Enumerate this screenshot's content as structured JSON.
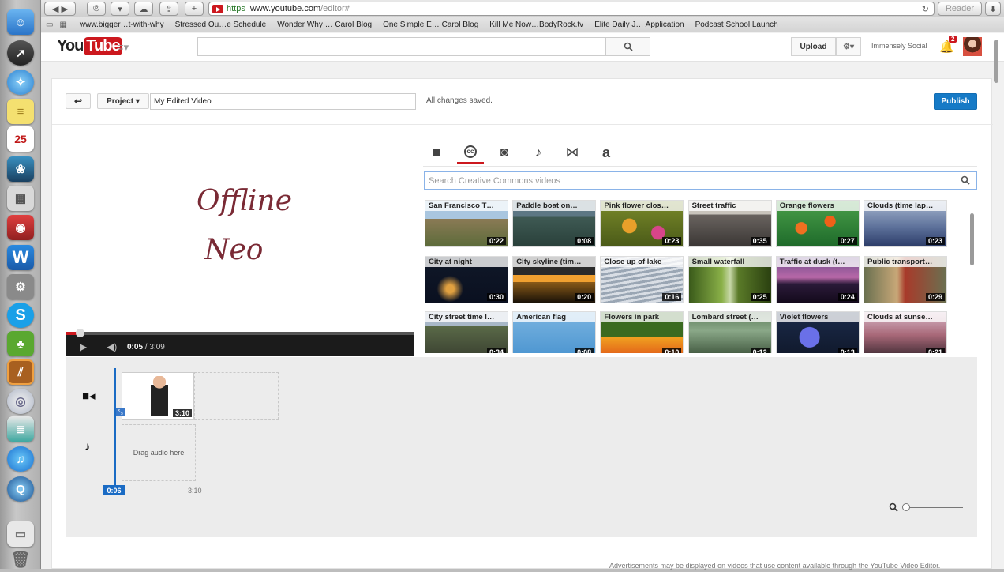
{
  "browser": {
    "url_scheme": "https",
    "url_host": "www.youtube.com",
    "url_path": "/editor#",
    "reader_label": "Reader"
  },
  "bookmarks": [
    "www.bigger…t-with-why",
    "Stressed Ou…e Schedule",
    "Wonder Why … Carol Blog",
    "One Simple E… Carol Blog",
    "Kill Me Now…BodyRock.tv",
    "Elite Daily J… Application",
    "Podcast School Launch"
  ],
  "dock": {
    "calendar_day": "25"
  },
  "header": {
    "logo_you": "You",
    "logo_tube": "Tube",
    "upload_label": "Upload",
    "account_name": "Immensely Social",
    "notification_count": "2"
  },
  "project": {
    "project_menu_label": "Project",
    "title_value": "My Edited Video",
    "status_text": "All changes saved.",
    "publish_label": "Publish"
  },
  "preview": {
    "title_line1": "Offline",
    "title_line2": "Neo",
    "current_time": "0:05",
    "duration": "3:09"
  },
  "library": {
    "tabs": [
      {
        "name": "tab-my-videos",
        "icon": "video-camera-icon",
        "glyph": "■"
      },
      {
        "name": "tab-creative-commons",
        "icon": "creative-commons-icon",
        "glyph": "cc"
      },
      {
        "name": "tab-photos",
        "icon": "camera-icon",
        "glyph": "◙"
      },
      {
        "name": "tab-audio",
        "icon": "music-note-icon",
        "glyph": "♪"
      },
      {
        "name": "tab-transitions",
        "icon": "transitions-icon",
        "glyph": "⋈"
      },
      {
        "name": "tab-text",
        "icon": "text-icon",
        "glyph": "a"
      }
    ],
    "active_tab": 1,
    "search_placeholder": "Search Creative Commons videos",
    "videos": [
      {
        "title": "San Francisco T…",
        "duration": "0:22",
        "bg": "linear-gradient(#a9c6df 0 40%,#8a7a55 40%,#5c6b3a)"
      },
      {
        "title": "Paddle boat on…",
        "duration": "0:08",
        "bg": "linear-gradient(#5d7784 0 35%,#3f5a54 35%,#29403a)"
      },
      {
        "title": "Pink flower clos…",
        "duration": "0:23",
        "bg": "radial-gradient(circle at 35% 55%,#e8a02a 0 12%,transparent 13%),radial-gradient(circle at 70% 70%,#d8458a 0 10%,transparent 11%),linear-gradient(#7a8a2a,#4a5a18)"
      },
      {
        "title": "Street traffic",
        "duration": "0:35",
        "bg": "linear-gradient(#c9c4bc 0 30%,#6a6460 30%,#3a3634)"
      },
      {
        "title": "Orange flowers",
        "duration": "0:27",
        "bg": "radial-gradient(circle at 30% 60%,#f07020 0 9%,transparent 10%),radial-gradient(circle at 65% 45%,#f06018 0 9%,transparent 10%),linear-gradient(#4aa04a,#1e6a2a)"
      },
      {
        "title": "Clouds (time lap…",
        "duration": "0:23",
        "bg": "linear-gradient(#a8b8d0,#5a6e98 60%,#2c3c68)"
      },
      {
        "title": "City at night",
        "duration": "0:30",
        "bg": "radial-gradient(circle at 30% 70%,#e0a040 0 6%,transparent 20%),linear-gradient(#101828,#0a1020)"
      },
      {
        "title": "City skyline (tim…",
        "duration": "0:20",
        "bg": "linear-gradient(#2a2a2a 0 40%,#f0a030 40% 55%,#8a5a18 55%,#1a1208)"
      },
      {
        "title": "Close up of lake",
        "duration": "0:16",
        "bg": "repeating-linear-gradient(170deg,#d8dde4 0 3px,#9aa6b4 3px 6px)"
      },
      {
        "title": "Small waterfall",
        "duration": "0:25",
        "bg": "linear-gradient(90deg,#3a5a1a,#8ab048 40%,#c8d8a8 50%,#5a7a28 60%,#2a4010)"
      },
      {
        "title": "Traffic at dusk (t…",
        "duration": "0:24",
        "bg": "linear-gradient(#6a4a8a,#b868a8 45%,#2a1a38 60%,#140a1c)"
      },
      {
        "title": "Public transport…",
        "duration": "0:29",
        "bg": "linear-gradient(90deg,#6a7050,#c8a878 40%,#a83a2a 50%,#6a7050)"
      },
      {
        "title": "City street time l…",
        "duration": "0:34",
        "bg": "linear-gradient(#a8b8c8 0 30%,#5a6a48 30%,#3a4030)"
      },
      {
        "title": "American flag",
        "duration": "0:08",
        "bg": "linear-gradient(#7ab4e0,#4a94d0)"
      },
      {
        "title": "Flowers in park",
        "duration": "0:10",
        "bg": "linear-gradient(#3a6a20 0 55%,#f0a020 55%,#e05818)"
      },
      {
        "title": "Lombard street (…",
        "duration": "0:12",
        "bg": "linear-gradient(#5a7a58,#8aa888 40%,#3a5038)"
      },
      {
        "title": "Violet flowers",
        "duration": "0:13",
        "bg": "radial-gradient(circle at 40% 55%,#6a70e8 0 18%,transparent 19%),linear-gradient(#1a2a4a,#10182a)"
      },
      {
        "title": "Clouds at sunse…",
        "duration": "0:21",
        "bg": "linear-gradient(#d8b8c8,#a86878 50%,#3a2830)"
      }
    ]
  },
  "timeline": {
    "clip_duration": "3:10",
    "audio_dropzone_label": "Drag audio here",
    "playhead_time": "0:06",
    "end_time": "3:10"
  },
  "footer_note": "Advertisements may be displayed on videos that use content available through the YouTube Video Editor."
}
